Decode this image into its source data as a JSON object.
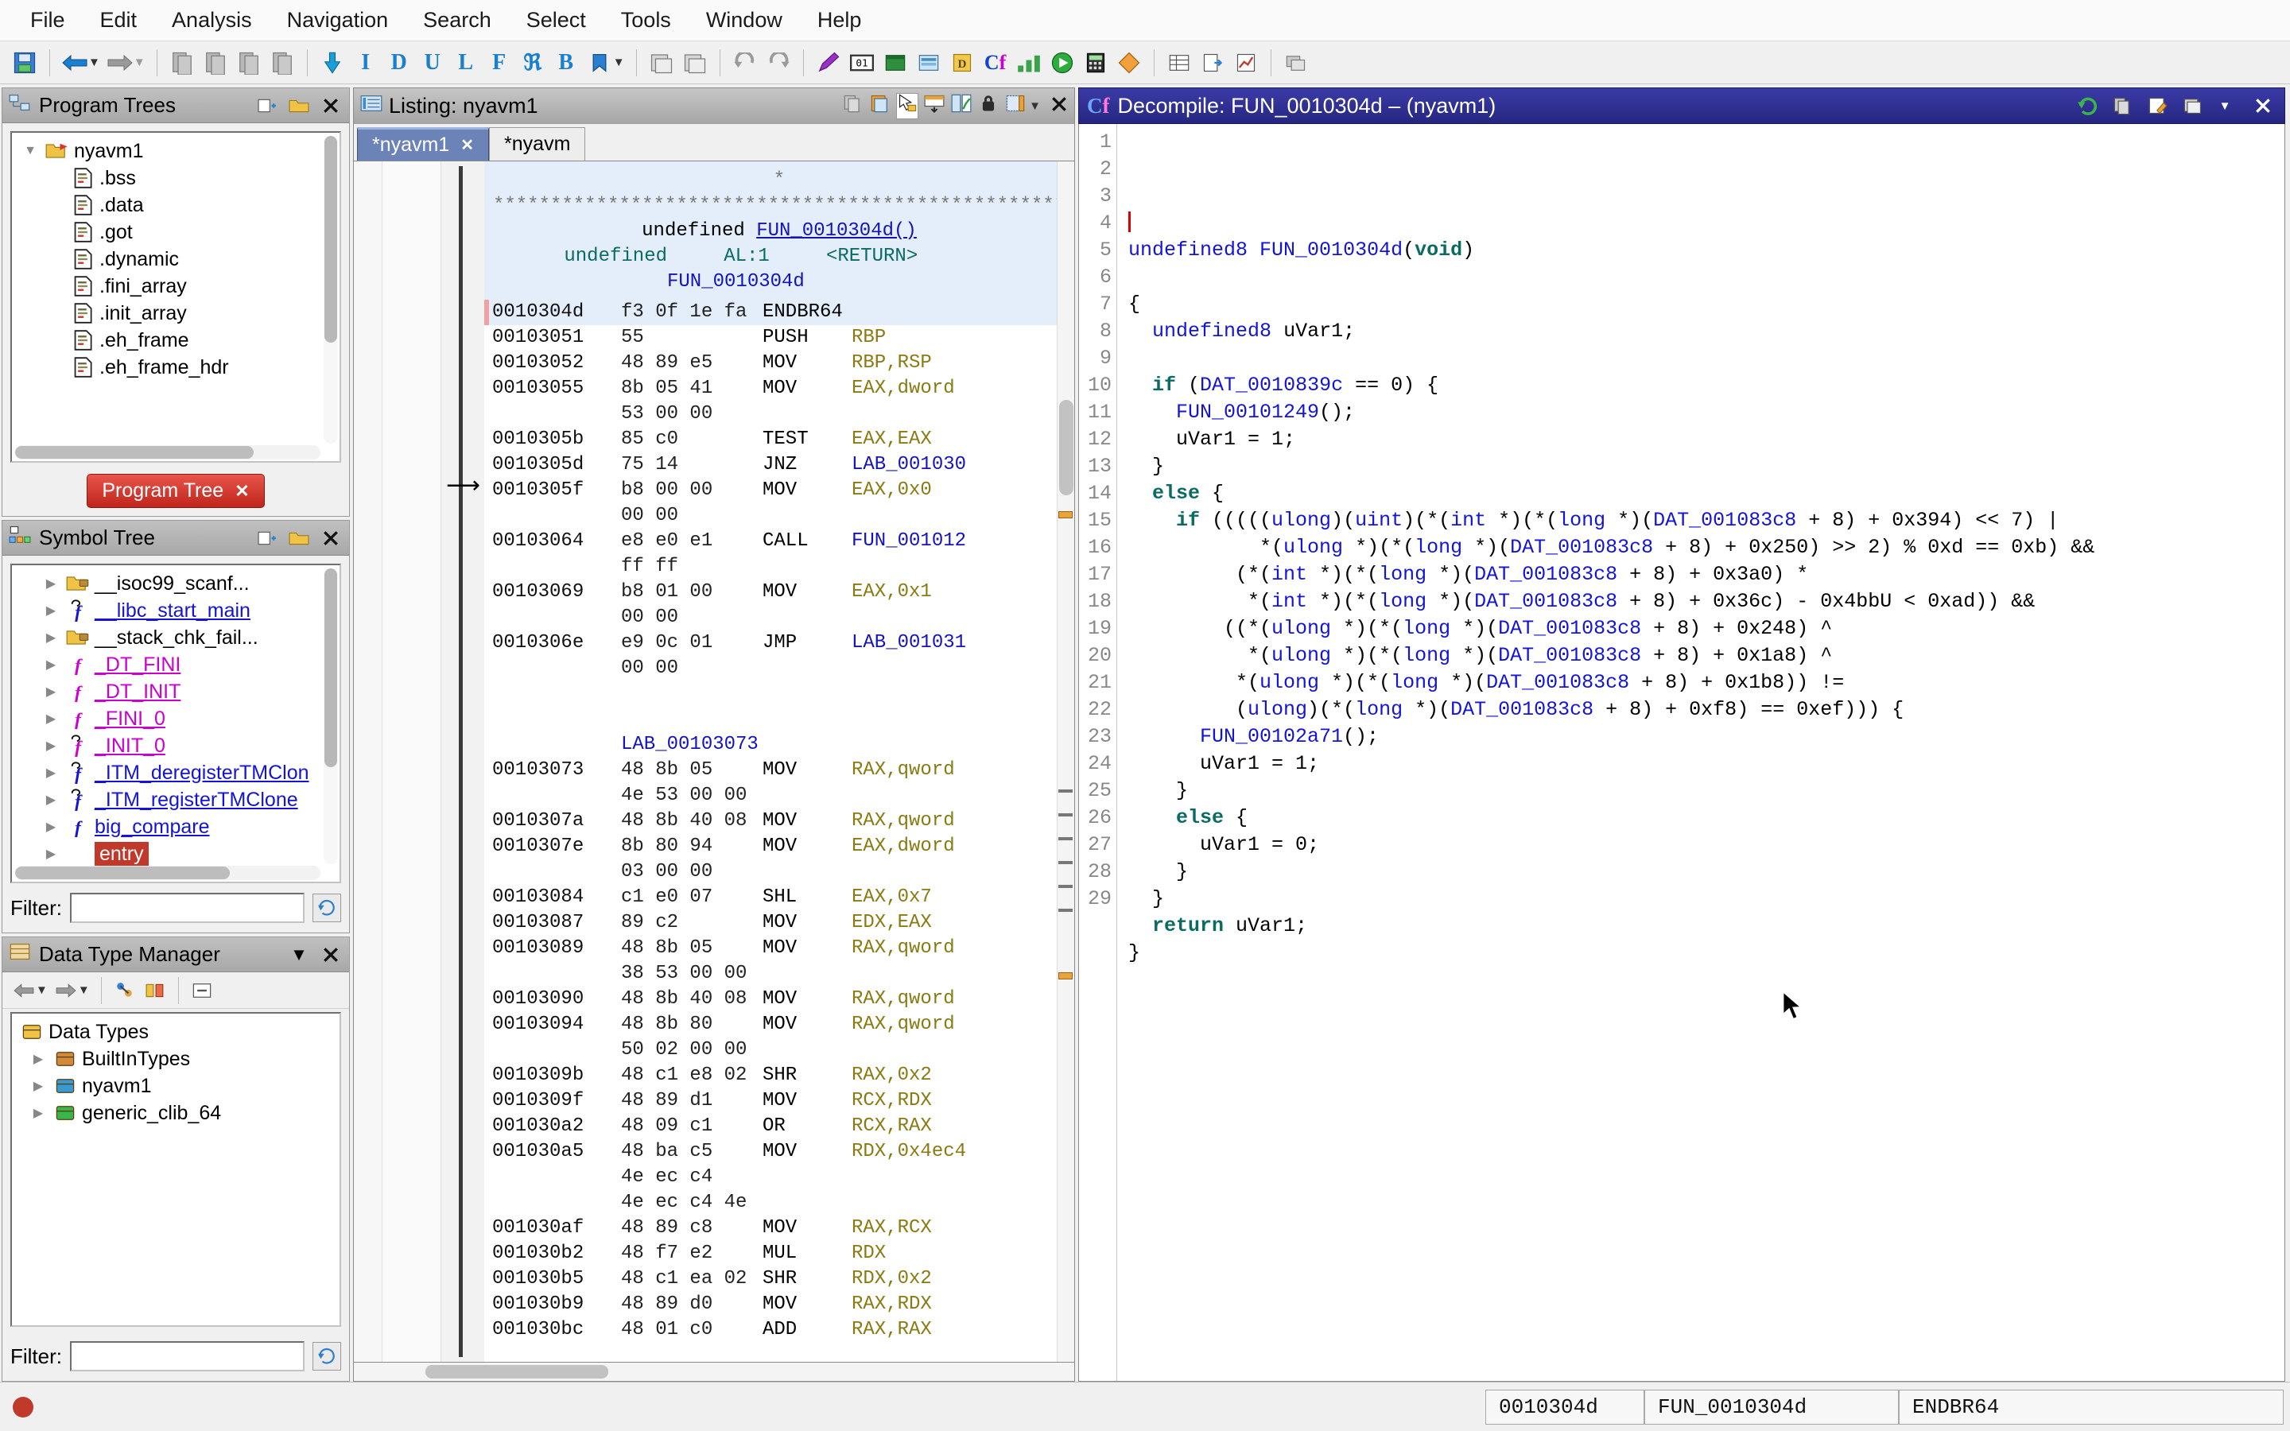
{
  "menubar": {
    "items": [
      "File",
      "Edit",
      "Analysis",
      "Navigation",
      "Search",
      "Select",
      "Tools",
      "Window",
      "Help"
    ]
  },
  "toolbar": {
    "groups": [
      [
        "save-icon"
      ],
      [
        "back-arrow-icon",
        "back-dropdown-icon",
        "forward-arrow-icon",
        "forward-dropdown-icon"
      ],
      [
        "prev-diff-icon",
        "next-diff-icon",
        "prev-diff2-icon",
        "next-diff2-icon"
      ],
      [
        "down-arrow-icon",
        "instruction-icon",
        "data-icon",
        "undefine-icon",
        "label-icon",
        "function-icon",
        "clear-flow-icon",
        "bytes-icon",
        "bookmark-icon",
        "bookmark-dropdown-icon"
      ],
      [
        "snapshot-icon",
        "copy-snapshot-icon"
      ],
      [
        "undo-icon",
        "redo-icon"
      ],
      [
        "edit-icon",
        "memory-icon",
        "window-icon",
        "archive-icon",
        "cfunction-icon",
        "graph-icon",
        "run-icon",
        "calculator-icon",
        "diamond-icon"
      ],
      [
        "table-icon",
        "export-icon",
        "chart-icon"
      ],
      [
        "refresh-window-icon"
      ]
    ]
  },
  "program_trees": {
    "title": "Program Trees",
    "title_icon": "program-tree-icon",
    "buttons": [
      "new-tree-icon",
      "open-tree-icon",
      "close-icon"
    ],
    "root": "nyavm1",
    "nodes": [
      ".bss",
      ".data",
      ".got",
      ".dynamic",
      ".fini_array",
      ".init_array",
      ".eh_frame",
      ".eh_frame_hdr"
    ],
    "tab_label": "Program Tree",
    "tab_close": "✕"
  },
  "symbol_tree": {
    "title": "Symbol Tree",
    "title_icon": "symbol-tree-icon",
    "buttons": [
      "create-icon",
      "rename-icon",
      "close-icon"
    ],
    "items": [
      {
        "label": "__isoc99_scanf...",
        "icon": "folder-icon",
        "color": "#000000",
        "selected": false
      },
      {
        "label": "__libc_start_main",
        "icon": "function-ext-icon",
        "color": "#1414d8",
        "selected": false
      },
      {
        "label": "__stack_chk_fail...",
        "icon": "folder-icon",
        "color": "#000000",
        "selected": false
      },
      {
        "label": "_DT_FINI",
        "icon": "function-icon",
        "color": "#cc00cc",
        "selected": false
      },
      {
        "label": "_DT_INIT",
        "icon": "function-icon",
        "color": "#cc00cc",
        "selected": false
      },
      {
        "label": "_FINI_0",
        "icon": "function-icon",
        "color": "#cc00cc",
        "selected": false
      },
      {
        "label": "_INIT_0",
        "icon": "function-ext-icon",
        "color": "#cc00cc",
        "selected": false
      },
      {
        "label": "_ITM_deregisterTMClon",
        "icon": "function-ext-icon",
        "color": "#1414d8",
        "selected": false
      },
      {
        "label": "_ITM_registerTMClone",
        "icon": "function-ext-icon",
        "color": "#1414d8",
        "selected": false
      },
      {
        "label": "big_compare",
        "icon": "function-icon",
        "color": "#1414d8",
        "selected": false
      },
      {
        "label": "entry",
        "icon": "function-icon",
        "color": "#ffffff",
        "selected": true
      }
    ],
    "filter_label": "Filter:",
    "filter_value": ""
  },
  "data_type_manager": {
    "title": "Data Type Manager",
    "title_icon": "datatype-icon",
    "buttons": [
      "dropdown-icon",
      "close-icon"
    ],
    "toolbar_icons": [
      "back-icon",
      "back-dropdown-icon",
      "forward-icon",
      "forward-dropdown-icon",
      "filter-pointer-icon",
      "filter-array-icon",
      "collapse-icon"
    ],
    "root": "Data Types",
    "nodes": [
      {
        "label": "BuiltInTypes",
        "icon": "builtin-archive-icon"
      },
      {
        "label": "nyavm1",
        "icon": "program-archive-icon"
      },
      {
        "label": "generic_clib_64",
        "icon": "file-archive-icon"
      }
    ],
    "filter_label": "Filter:",
    "filter_value": ""
  },
  "listing": {
    "title": "Listing:  nyavm1",
    "title_icon": "listing-icon",
    "toolbar_icons": [
      "copy-icon",
      "paste-icon",
      "select-cursor-icon",
      "table-add-icon",
      "diff-icon",
      "lock-icon",
      "layout-icon",
      "layout-dropdown-icon",
      "close-icon"
    ],
    "tabs": [
      {
        "label": "*nyavm1",
        "active": true,
        "close": "✕"
      },
      {
        "label": "*nyavm",
        "active": false,
        "close": ""
      }
    ],
    "header": {
      "star_single": "*",
      "star_rule": "**************************************************",
      "signature_type": "undefined",
      "signature_fn": "FUN_0010304d()",
      "ret_type": "undefined",
      "ret_reg": "AL:1",
      "ret_label": "<RETURN>",
      "label": "FUN_0010304d"
    },
    "rows": [
      {
        "addr": "0010304d",
        "bytes": "f3 0f 1e fa",
        "mnem": "ENDBR64",
        "ops": "",
        "current": true
      },
      {
        "addr": "00103051",
        "bytes": "55",
        "mnem": "PUSH",
        "ops": "RBP"
      },
      {
        "addr": "00103052",
        "bytes": "48 89 e5",
        "mnem": "MOV",
        "ops": "RBP,RSP"
      },
      {
        "addr": "00103055",
        "bytes": "8b 05 41",
        "mnem": "MOV",
        "ops": "EAX,dword"
      },
      {
        "addr": "",
        "bytes": "53 00 00",
        "mnem": "",
        "ops": ""
      },
      {
        "addr": "0010305b",
        "bytes": "85 c0",
        "mnem": "TEST",
        "ops": "EAX,EAX"
      },
      {
        "addr": "0010305d",
        "bytes": "75 14",
        "mnem": "JNZ",
        "ops": "LAB_001030",
        "islabel": true
      },
      {
        "addr": "0010305f",
        "bytes": "b8 00 00",
        "mnem": "MOV",
        "ops": "EAX,0x0"
      },
      {
        "addr": "",
        "bytes": "00 00",
        "mnem": "",
        "ops": ""
      },
      {
        "addr": "00103064",
        "bytes": "e8 e0 e1",
        "mnem": "CALL",
        "ops": "FUN_001012",
        "islabel": true
      },
      {
        "addr": "",
        "bytes": "ff ff",
        "mnem": "",
        "ops": ""
      },
      {
        "addr": "00103069",
        "bytes": "b8 01 00",
        "mnem": "MOV",
        "ops": "EAX,0x1"
      },
      {
        "addr": "",
        "bytes": "00 00",
        "mnem": "",
        "ops": ""
      },
      {
        "addr": "0010306e",
        "bytes": "e9 0c 01",
        "mnem": "JMP",
        "ops": "LAB_001031",
        "islabel": true
      },
      {
        "addr": "",
        "bytes": "00 00",
        "mnem": "",
        "ops": ""
      },
      {
        "addr": "",
        "bytes": "",
        "mnem": "",
        "ops": ""
      },
      {
        "label_row": "LAB_00103073"
      },
      {
        "addr": "00103073",
        "bytes": "48 8b 05",
        "mnem": "MOV",
        "ops": "RAX,qword"
      },
      {
        "addr": "",
        "bytes": "4e 53 00 00",
        "mnem": "",
        "ops": ""
      },
      {
        "addr": "0010307a",
        "bytes": "48 8b 40 08",
        "mnem": "MOV",
        "ops": "RAX,qword"
      },
      {
        "addr": "0010307e",
        "bytes": "8b 80 94",
        "mnem": "MOV",
        "ops": "EAX,dword"
      },
      {
        "addr": "",
        "bytes": "03 00 00",
        "mnem": "",
        "ops": ""
      },
      {
        "addr": "00103084",
        "bytes": "c1 e0 07",
        "mnem": "SHL",
        "ops": "EAX,0x7"
      },
      {
        "addr": "00103087",
        "bytes": "89 c2",
        "mnem": "MOV",
        "ops": "EDX,EAX"
      },
      {
        "addr": "00103089",
        "bytes": "48 8b 05",
        "mnem": "MOV",
        "ops": "RAX,qword"
      },
      {
        "addr": "",
        "bytes": "38 53 00 00",
        "mnem": "",
        "ops": ""
      },
      {
        "addr": "00103090",
        "bytes": "48 8b 40 08",
        "mnem": "MOV",
        "ops": "RAX,qword"
      },
      {
        "addr": "00103094",
        "bytes": "48 8b 80",
        "mnem": "MOV",
        "ops": "RAX,qword"
      },
      {
        "addr": "",
        "bytes": "50 02 00 00",
        "mnem": "",
        "ops": ""
      },
      {
        "addr": "0010309b",
        "bytes": "48 c1 e8 02",
        "mnem": "SHR",
        "ops": "RAX,0x2"
      },
      {
        "addr": "0010309f",
        "bytes": "48 89 d1",
        "mnem": "MOV",
        "ops": "RCX,RDX"
      },
      {
        "addr": "001030a2",
        "bytes": "48 09 c1",
        "mnem": "OR",
        "ops": "RCX,RAX"
      },
      {
        "addr": "001030a5",
        "bytes": "48 ba c5",
        "mnem": "MOV",
        "ops": "RDX,0x4ec4"
      },
      {
        "addr": "",
        "bytes": "4e ec c4",
        "mnem": "",
        "ops": ""
      },
      {
        "addr": "",
        "bytes": "4e ec c4 4e",
        "mnem": "",
        "ops": ""
      },
      {
        "addr": "001030af",
        "bytes": "48 89 c8",
        "mnem": "MOV",
        "ops": "RAX,RCX"
      },
      {
        "addr": "001030b2",
        "bytes": "48 f7 e2",
        "mnem": "MUL",
        "ops": "RDX"
      },
      {
        "addr": "001030b5",
        "bytes": "48 c1 ea 02",
        "mnem": "SHR",
        "ops": "RDX,0x2"
      },
      {
        "addr": "001030b9",
        "bytes": "48 89 d0",
        "mnem": "MOV",
        "ops": "RAX,RDX"
      },
      {
        "addr": "001030bc",
        "bytes": "48 01 c0",
        "mnem": "ADD",
        "ops": "RAX,RAX"
      }
    ]
  },
  "decompile": {
    "title": "Decompile: FUN_0010304d –  (nyavm1)",
    "title_icon": "cfunction-icon",
    "buttons": [
      "refresh-icon",
      "copy-icon",
      "edit-icon",
      "snapshot-icon",
      "menu-dropdown-icon",
      "close-icon"
    ],
    "lines": [
      {
        "n": 1,
        "text": "",
        "cursor": true
      },
      {
        "n": 2,
        "text": "undefined8 FUN_0010304d(void)"
      },
      {
        "n": 3,
        "text": ""
      },
      {
        "n": 4,
        "text": "{"
      },
      {
        "n": 5,
        "text": "  undefined8 uVar1;"
      },
      {
        "n": 6,
        "text": ""
      },
      {
        "n": 7,
        "text": "  if (DAT_0010839c == 0) {"
      },
      {
        "n": 8,
        "text": "    FUN_00101249();"
      },
      {
        "n": 9,
        "text": "    uVar1 = 1;"
      },
      {
        "n": 10,
        "text": "  }"
      },
      {
        "n": 11,
        "text": "  else {"
      },
      {
        "n": 12,
        "text": "    if (((((ulong)(uint)(*(int *)(*(long *)(DAT_001083c8 + 8) + 0x394) << 7) |"
      },
      {
        "n": 13,
        "text": "           *(ulong *)(*(long *)(DAT_001083c8 + 8) + 0x250) >> 2) % 0xd == 0xb) &&"
      },
      {
        "n": 14,
        "text": "         (*(int *)(*(long *)(DAT_001083c8 + 8) + 0x3a0) *"
      },
      {
        "n": 15,
        "text": "          *(int *)(*(long *)(DAT_001083c8 + 8) + 0x36c) - 0x4bbU < 0xad)) &&"
      },
      {
        "n": 16,
        "text": "        ((*(ulong *)(*(long *)(DAT_001083c8 + 8) + 0x248) ^"
      },
      {
        "n": 17,
        "text": "          *(ulong *)(*(long *)(DAT_001083c8 + 8) + 0x1a8) ^"
      },
      {
        "n": 18,
        "text": "         *(ulong *)(*(long *)(DAT_001083c8 + 8) + 0x1b8)) !="
      },
      {
        "n": 19,
        "text": "         (ulong)(*(long *)(DAT_001083c8 + 8) + 0xf8) == 0xef))) {"
      },
      {
        "n": 20,
        "text": "      FUN_00102a71();"
      },
      {
        "n": 21,
        "text": "      uVar1 = 1;"
      },
      {
        "n": 22,
        "text": "    }"
      },
      {
        "n": 23,
        "text": "    else {"
      },
      {
        "n": 24,
        "text": "      uVar1 = 0;"
      },
      {
        "n": 25,
        "text": "    }"
      },
      {
        "n": 26,
        "text": "  }"
      },
      {
        "n": 27,
        "text": "  return uVar1;"
      },
      {
        "n": 28,
        "text": "}"
      },
      {
        "n": 29,
        "text": ""
      }
    ]
  },
  "statusbar": {
    "indicator_icon": "record-icon",
    "address": "0010304d",
    "function": "FUN_0010304d",
    "instruction": "ENDBR64"
  },
  "colors": {
    "accent_blue": "#6b83b7",
    "decomp_title": "#262680",
    "selection_red": "#c0392b",
    "keyword_teal": "#0a6b63",
    "identifier_blue": "#1414d8",
    "operand_olive": "#8a7a12",
    "header_bg": "#e4eefb"
  }
}
